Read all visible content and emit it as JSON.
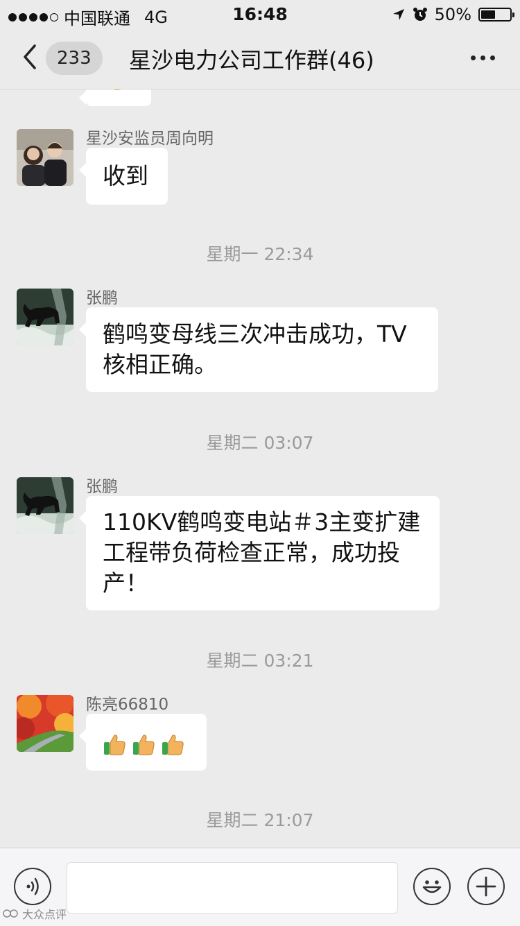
{
  "status_bar": {
    "carrier": "中国联通",
    "network": "4G",
    "time": "16:48",
    "battery": "50%",
    "battery_level": 0.5
  },
  "header": {
    "back_icon": "chevron-left-icon",
    "unread_count": "233",
    "title": "星沙电力公司工作群(46)",
    "more_icon": "more-dots-icon"
  },
  "messages": [
    {
      "sender": "星沙安监员周向明",
      "text": "收到"
    },
    {
      "timestamp": "星期一 22:34"
    },
    {
      "sender": "张鹏",
      "line1": "鹤鸣变母线三次冲击成功，TV",
      "line2": "核相正确。"
    },
    {
      "timestamp": "星期二 03:07"
    },
    {
      "sender": "张鹏",
      "line1": "110KV鹤鸣变电站＃3主变扩建",
      "line2": "工程带负荷检查正常，成功投",
      "line3": "产！"
    },
    {
      "timestamp": "星期二 03:21"
    },
    {
      "sender": "陈亮66810",
      "emojis": [
        "thumbs-up-icon",
        "thumbs-up-icon",
        "thumbs-up-icon"
      ]
    },
    {
      "timestamp": "星期二 21:07"
    }
  ],
  "input_bar": {
    "voice_icon": "voice-icon",
    "emoji_icon": "smiley-icon",
    "plus_icon": "plus-icon"
  },
  "watermark": "大众点评"
}
